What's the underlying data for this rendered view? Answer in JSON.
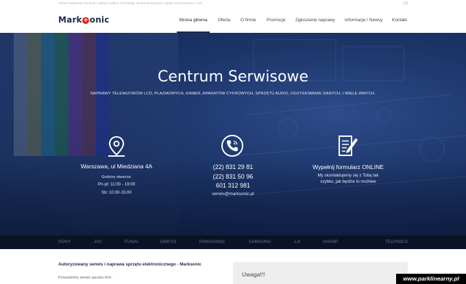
{
  "cookie_bar": {
    "text": "Serwis Marksonic korzysta z plików cookies. Pozostając na stronie wyrażasz zgodę na korzystanie z nich.",
    "close": "[X]"
  },
  "header": {
    "logo_left": "Mark",
    "logo_plus": "+",
    "logo_right": "onic",
    "nav": [
      "Strona główna",
      "Oferta",
      "O firmie",
      "Promocje",
      "Zgłoszenie naprawy",
      "Informacje / Newsy",
      "Kontakt"
    ]
  },
  "hero": {
    "title": "Centrum Serwisowe",
    "subtitle": "NAPRAWY TELEWIZORÓW LCD, PLAZMOWYCH, KAMER, APARATÓW CYFROWYCH, SPRZĘTU AUDIO, ODZYSKIWANIE DANYCH, I WIELE INNYCH.",
    "location": {
      "title": "Warszawa, ul Miedziana 4A",
      "hours_label": "Godziny otwarcia:",
      "hours_week": "Pn-pt: 11:00 - 19:00",
      "hours_sat": "Sb: 10:00-15:00"
    },
    "phone": {
      "line1": "(22) 831 29 81",
      "line2": "(22) 831 50 96",
      "line3": "601 312 981",
      "email": "serwis@marksonic.pl"
    },
    "form": {
      "title": "Wypełnij formularz ONLINE",
      "line1": "My skontaktujemy się z Tobą tak",
      "line2": "szybko, jak będzie to możliwe"
    }
  },
  "brands": [
    "SONY",
    "JVC",
    "FUNAI",
    "ONKYO",
    "PANASONIC",
    "SAMSUNG",
    "LG",
    "SHARP",
    "TECHNICS"
  ],
  "content": {
    "title": "Autoryzowany serwis i naprawa sprzętu elektronicznego - Marksonic",
    "text": "Prowadzimy serwis sprzętu firm:",
    "alert_title": "Uwaga!!!"
  },
  "watermark": "www.parklinearny.pl",
  "colors": {
    "brand_navy": "#1d2a4a",
    "logo_red": "#e2231a",
    "hero_blue": "#1b3366",
    "brand_strip": "#0a1325"
  }
}
